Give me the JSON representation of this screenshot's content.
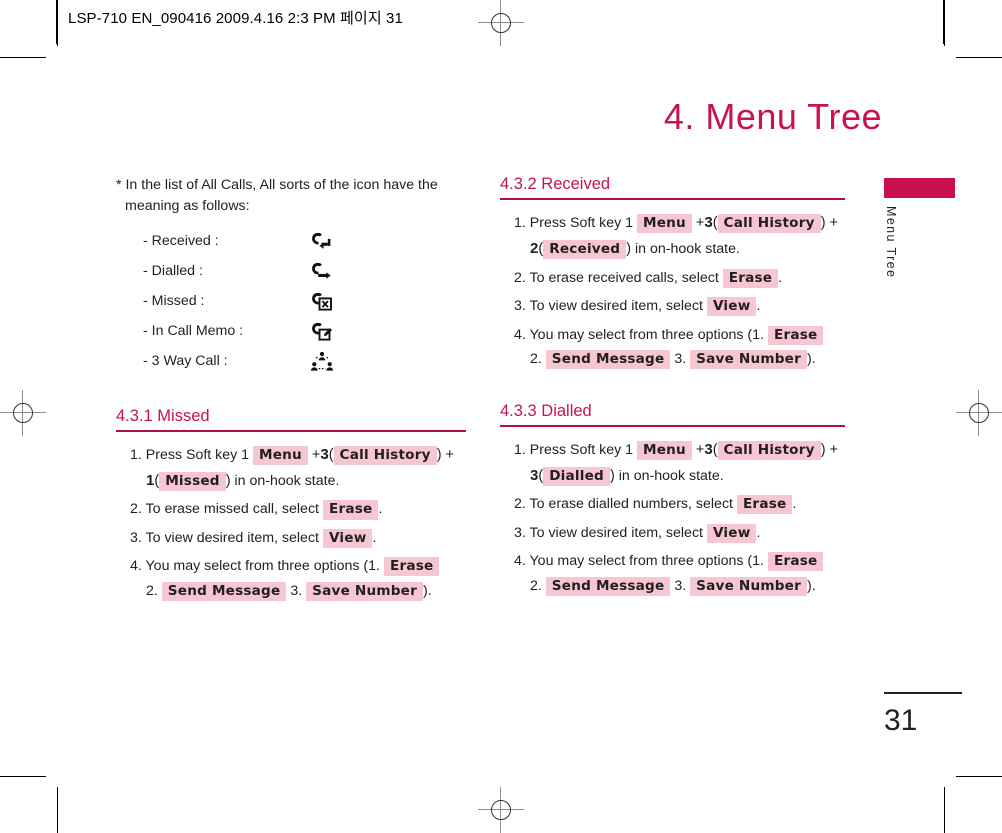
{
  "header": {
    "slug": "LSP-710 EN_090416  2009.4.16 2:3 PM  페이지 31"
  },
  "chapter": {
    "title": "4. Menu Tree"
  },
  "side_tab": {
    "label": "Menu Tree",
    "color": "#c8104c"
  },
  "page": {
    "number": "31"
  },
  "colors": {
    "accent": "#c8134d",
    "rule": "#b0104a",
    "key_highlight": "#f6c6d2",
    "text": "#231f20"
  },
  "note": {
    "marker": "*",
    "lead": "In the list of All Calls, All sorts of the icon have the meaning as follows:",
    "items": [
      {
        "label": "- Received  :",
        "icon": "call-received-icon"
      },
      {
        "label": "- Dialled :",
        "icon": "call-dialled-icon"
      },
      {
        "label": "- Missed :",
        "icon": "call-missed-icon"
      },
      {
        "label": "- In Call Memo :",
        "icon": "in-call-memo-icon"
      },
      {
        "label": "- 3 Way Call  :",
        "icon": "three-way-call-icon"
      }
    ]
  },
  "sections": {
    "missed": {
      "heading": "4.3.1 Missed",
      "steps": {
        "s1_a": "1. Press Soft key 1",
        "s1_key_menu": "Menu",
        "s1_plus1": "+",
        "s1_num3": "3",
        "s1_open1": "(",
        "s1_key_callhistory": "Call History",
        "s1_close1": ")",
        "s1_plus2": "+",
        "s1_num_select": "1",
        "s1_open2": "(",
        "s1_key_select": "Missed",
        "s1_close2": ")",
        "s1_tail": "in on-hook state.",
        "s2_a": "2. To erase missed call, select",
        "s2_key": "Erase",
        "s2_tail": ".",
        "s3_a": "3. To view desired item, select",
        "s3_key": "View",
        "s3_tail": ".",
        "s4_a": "4. You may select from three options (1.",
        "s4_key1": "Erase",
        "s4_n2": "2.",
        "s4_key2": "Send Message",
        "s4_n3": "3.",
        "s4_key3": "Save Number",
        "s4_tail": ")."
      }
    },
    "received": {
      "heading": "4.3.2 Received",
      "steps": {
        "s1_a": "1. Press Soft key 1",
        "s1_key_menu": "Menu",
        "s1_plus1": "+",
        "s1_num3": "3",
        "s1_open1": "(",
        "s1_key_callhistory": "Call History",
        "s1_close1": ")",
        "s1_plus2": "+",
        "s1_num_select": "2",
        "s1_open2": "(",
        "s1_key_select": "Received",
        "s1_close2": ")",
        "s1_tail": "in on-hook state.",
        "s2_a": "2. To erase received calls, select",
        "s2_key": "Erase",
        "s2_tail": ".",
        "s3_a": "3.  To view desired item, select",
        "s3_key": "View",
        "s3_tail": ".",
        "s4_a": "4. You may select from three options (1.",
        "s4_key1": "Erase",
        "s4_n2": "2.",
        "s4_key2": "Send Message",
        "s4_n3": "3.",
        "s4_key3": "Save Number",
        "s4_tail": ")."
      }
    },
    "dialled": {
      "heading": "4.3.3 Dialled",
      "steps": {
        "s1_a": "1. Press Soft key 1",
        "s1_key_menu": "Menu",
        "s1_plus1": "+",
        "s1_num3": "3",
        "s1_open1": "(",
        "s1_key_callhistory": "Call History",
        "s1_close1": ")",
        "s1_plus2": "+",
        "s1_num_select": "3",
        "s1_open2": "(",
        "s1_key_select": "Dialled",
        "s1_close2": ")",
        "s1_tail": "in on-hook state.",
        "s2_a": "2. To erase dialled numbers, select",
        "s2_key": "Erase",
        "s2_tail": ".",
        "s3_a": "3. To view desired item, select",
        "s3_key": "View",
        "s3_tail": ".",
        "s4_a": "4. You may select from three options (1.",
        "s4_key1": "Erase",
        "s4_n2": "2.",
        "s4_key2": "Send Message",
        "s4_n3": "3.",
        "s4_key3": "Save Number",
        "s4_tail": ")."
      }
    }
  }
}
